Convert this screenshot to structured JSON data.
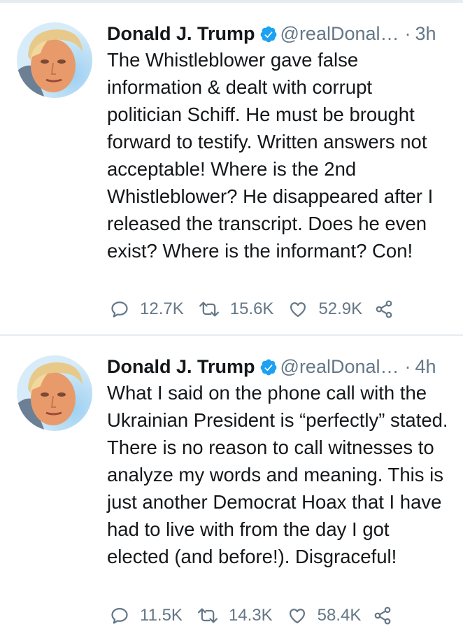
{
  "tweets": [
    {
      "author": {
        "name": "Donald J. Trump",
        "handle": "@realDonal…",
        "verified": true,
        "avatar_icon": "profile-photo-avatar"
      },
      "separator": "·",
      "time": "3h",
      "text": "The Whistleblower gave false\ninformation & dealt with corrupt\npolitician Schiff. He must be brought\nforward to testify. Written answers not\nacceptable! Where is the 2nd\nWhistleblower? He disappeared after I\nreleased the transcript. Does he even\nexist? Where is the informant? Con!",
      "stats": {
        "replies": "12.7K",
        "retweets": "15.6K",
        "likes": "52.9K"
      }
    },
    {
      "author": {
        "name": "Donald J. Trump",
        "handle": "@realDonal…",
        "verified": true,
        "avatar_icon": "profile-photo-avatar"
      },
      "separator": "·",
      "time": "4h",
      "text": "What I said on the phone call with the\nUkrainian President is “perfectly” stated.\nThere is no reason to call witnesses to\nanalyze my words and meaning. This is\njust another Democrat Hoax that I have\nhad to live with from the day I got\nelected (and before!). Disgraceful!",
      "stats": {
        "replies": "11.5K",
        "retweets": "14.3K",
        "likes": "58.4K"
      }
    }
  ],
  "icons": {
    "reply": "reply-icon",
    "retweet": "retweet-icon",
    "like": "heart-icon",
    "share": "share-icon",
    "verified": "verified-badge-icon"
  },
  "colors": {
    "text": "#14171a",
    "secondary": "#657786",
    "verified_blue": "#1da1f2",
    "divider": "#e6ecf0"
  }
}
